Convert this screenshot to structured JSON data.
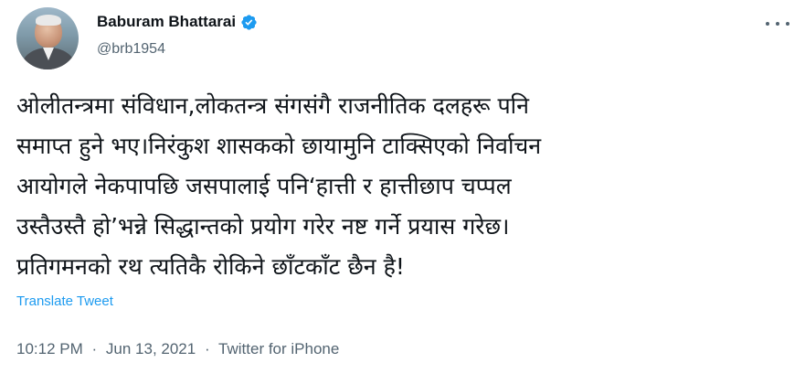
{
  "author": {
    "name": "Baburam Bhattarai",
    "handle": "@brb1954",
    "verified": true
  },
  "tweet": {
    "lines": [
      "ओलीतन्त्रमा संविधान,लोकतन्त्र संगसंगै राजनीतिक दलहरू पनि",
      "समाप्त हुने भए।निरंकुश शासकको छायामुनि टाक्सिएको निर्वाचन",
      "आयोगले नेकपापछि जसपालाई पनि‘हात्ती र हात्तीछाप चप्पल",
      "उस्तैउस्तै हो’भन्ने सिद्धान्तको प्रयोग गरेर नष्ट गर्ने प्रयास गरेछ।",
      "प्रतिगमनको रथ त्यतिकै रोकिने छाँटकाँट छैन है!"
    ],
    "translate_label": "Translate Tweet"
  },
  "meta": {
    "time": "10:12 PM",
    "date": "Jun 13, 2021",
    "source": "Twitter for iPhone",
    "separator": "·"
  },
  "colors": {
    "text": "#0f1419",
    "secondary": "#536471",
    "accent": "#1d9bf0"
  },
  "icons": {
    "verified": "verified-badge-icon",
    "more": "more-options-icon"
  }
}
